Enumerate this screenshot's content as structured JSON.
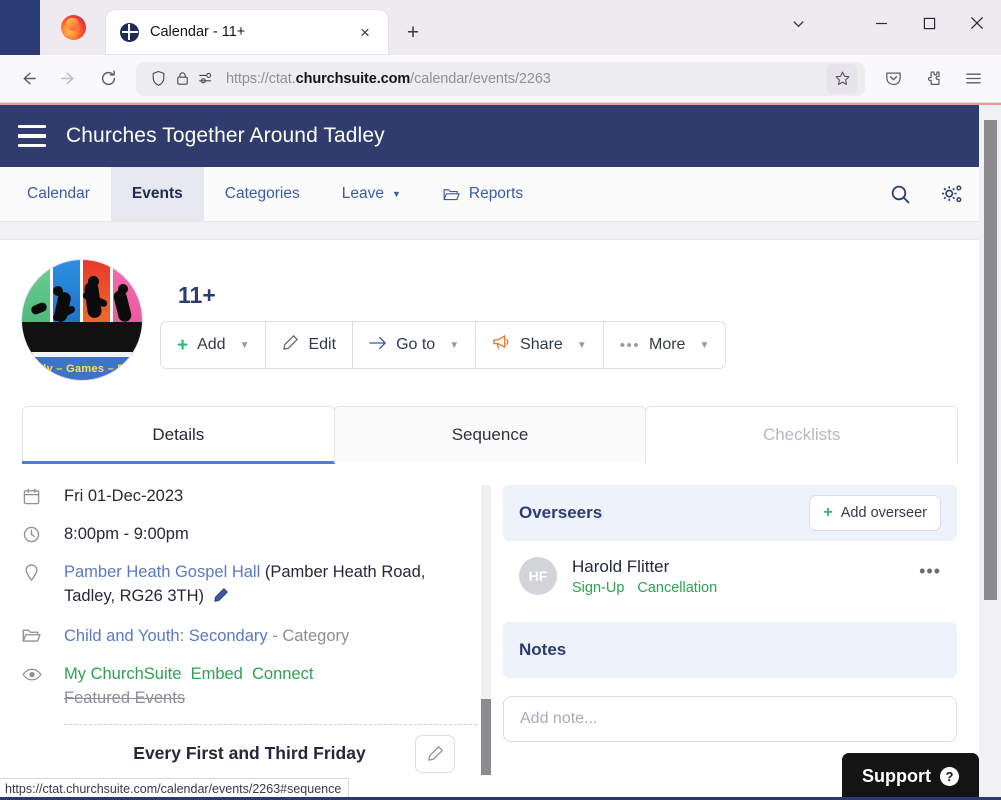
{
  "browser": {
    "tab": {
      "title": "Calendar - 11+",
      "favicon": "churchsuite-icon",
      "close": "×"
    },
    "newtab_label": "+",
    "window": {
      "list_all_tabs": "⌄",
      "minimize": "—",
      "maximize": "□",
      "close": "✕"
    },
    "nav": {
      "back": "←",
      "forward": "→",
      "reload": "↻"
    },
    "url": {
      "prefix": "https://ctat.",
      "domain": "churchsuite.com",
      "path": "/calendar/events/2263",
      "full": "https://ctat.churchsuite.com/calendar/events/2263"
    },
    "toolbar_icons": [
      "shield-icon",
      "lock-icon",
      "permissions-icon",
      "bookmark-star-icon",
      "pocket-icon",
      "extensions-icon",
      "app-menu-icon"
    ],
    "status_url": "https://ctat.churchsuite.com/calendar/events/2263#sequence"
  },
  "app": {
    "header": {
      "menu": "hamburger-icon",
      "title": "Churches Together Around Tadley"
    },
    "nav": {
      "items": [
        {
          "label": "Calendar",
          "active": false,
          "caret": false,
          "icon": null
        },
        {
          "label": "Events",
          "active": true,
          "caret": false,
          "icon": null
        },
        {
          "label": "Categories",
          "active": false,
          "caret": false,
          "icon": null
        },
        {
          "label": "Leave",
          "active": false,
          "caret": true,
          "icon": null
        },
        {
          "label": "Reports",
          "active": false,
          "caret": false,
          "icon": "folder-icon"
        }
      ],
      "actions": [
        "search-icon",
        "settings-gears-icon"
      ]
    }
  },
  "event": {
    "title": "11+",
    "logo": {
      "alt": "11+ youth group logo",
      "band_text": "dy – Games – F",
      "stripe_colors": [
        "#4fb36a",
        "#1f7fd6",
        "#e03a2f",
        "#ef7c2a",
        "#e0509f"
      ]
    },
    "actions": [
      {
        "label": "Add",
        "icon": "plus-icon",
        "caret": true
      },
      {
        "label": "Edit",
        "icon": "pencil-icon",
        "caret": false
      },
      {
        "label": "Go to",
        "icon": "arrow-right-icon",
        "caret": true
      },
      {
        "label": "Share",
        "icon": "megaphone-icon",
        "caret": true
      },
      {
        "label": "More",
        "icon": "ellipsis-icon",
        "caret": true
      }
    ],
    "tabs": [
      {
        "label": "Details",
        "state": "active"
      },
      {
        "label": "Sequence",
        "state": "default"
      },
      {
        "label": "Checklists",
        "state": "disabled"
      }
    ],
    "details": {
      "date": {
        "icon": "calendar-icon",
        "value": "Fri 01-Dec-2023"
      },
      "time": {
        "icon": "clock-icon",
        "value": "8:00pm - 9:00pm"
      },
      "location": {
        "icon": "map-pin-icon",
        "link": "Pamber Heath Gospel Hall",
        "address": " (Pamber Heath Road, Tadley, RG26 3TH) ",
        "edit_icon": "pencil-icon"
      },
      "category": {
        "icon": "folder-icon",
        "link": "Child and Youth: Secondary",
        "suffix": " - Category"
      },
      "visibility": {
        "icon": "eye-icon",
        "links": [
          "My ChurchSuite",
          "Embed",
          "Connect"
        ],
        "disabled_link": "Featured Events"
      },
      "sequence": {
        "title": "Every First and Third Friday",
        "edit_icon": "pencil-icon"
      }
    },
    "overseers": {
      "heading": "Overseers",
      "add_label": "Add overseer",
      "add_icon": "plus-icon",
      "people": [
        {
          "initials": "HF",
          "name": "Harold Flitter",
          "links": [
            "Sign-Up",
            "Cancellation"
          ],
          "menu": "ellipsis-icon"
        }
      ]
    },
    "notes": {
      "heading": "Notes",
      "input_placeholder": "Add note...",
      "input_value": ""
    }
  },
  "support": {
    "label": "Support",
    "icon": "question-mark-icon"
  },
  "colors": {
    "header_navy": "#303c6d",
    "accent_blue": "#3b5aa8",
    "link_green": "#2ba24f",
    "plus_green": "#2eb872",
    "share_orange": "#e8762c",
    "tab_underline": "#4a7fd4",
    "loadbar_pink": "#eb9a9a",
    "card_bg": "#eef2fa",
    "support_black": "#141414"
  }
}
